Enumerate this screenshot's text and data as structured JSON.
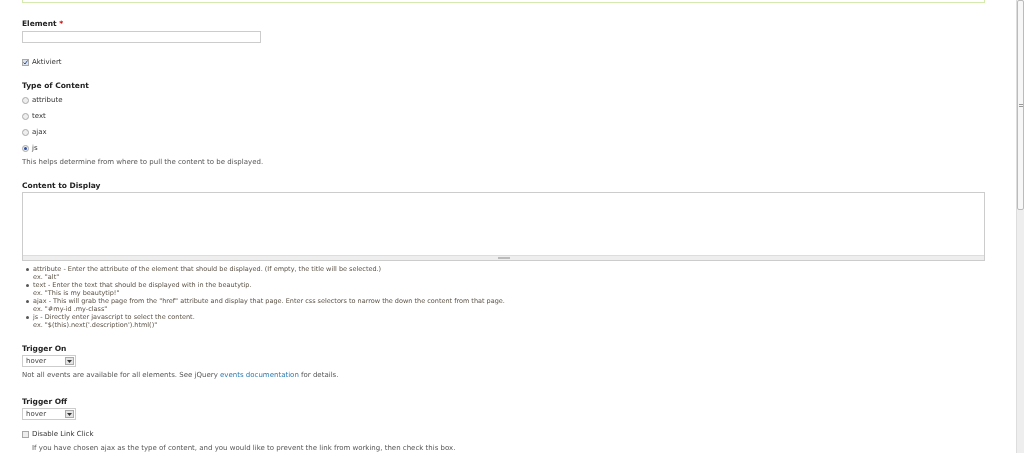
{
  "element_field": {
    "label": "Element",
    "required_mark": "*"
  },
  "enabled": {
    "label": "Aktiviert",
    "checked": true
  },
  "type_of_content": {
    "label": "Type of Content",
    "options": [
      {
        "label": "attribute",
        "selected": false
      },
      {
        "label": "text",
        "selected": false
      },
      {
        "label": "ajax",
        "selected": false
      },
      {
        "label": "js",
        "selected": true
      }
    ],
    "help": "This helps determine from where to pull the content to be displayed."
  },
  "content_to_display": {
    "label": "Content to Display",
    "items": [
      {
        "text": "attribute - Enter the attribute of the element that should be displayed. (If empty, the title will be selected.)",
        "example": "ex. \"alt\""
      },
      {
        "text": "text - Enter the text that should be displayed with in the beautytip.",
        "example": "ex. \"This is my beautytip!\""
      },
      {
        "text": "ajax - This will grab the page from the \"href\" attribute and display that page. Enter css selectors to narrow the down the content from that page.",
        "example": "ex. \"#my-id .my-class\""
      },
      {
        "text": "js - Directly enter javascript to select the content.",
        "example": "ex. \"$(this).next('.description').html()\""
      }
    ]
  },
  "trigger_on": {
    "label": "Trigger On",
    "value": "hover",
    "help_before": "Not all events are available for all elements. See jQuery ",
    "help_link": "events documentation",
    "help_after": " for details."
  },
  "trigger_off": {
    "label": "Trigger Off",
    "value": "hover"
  },
  "disable_link_click": {
    "label": "Disable Link Click",
    "checked": false,
    "help": "If you have chosen ajax as the type of content, and you would like to prevent the link from working, then check this box."
  }
}
